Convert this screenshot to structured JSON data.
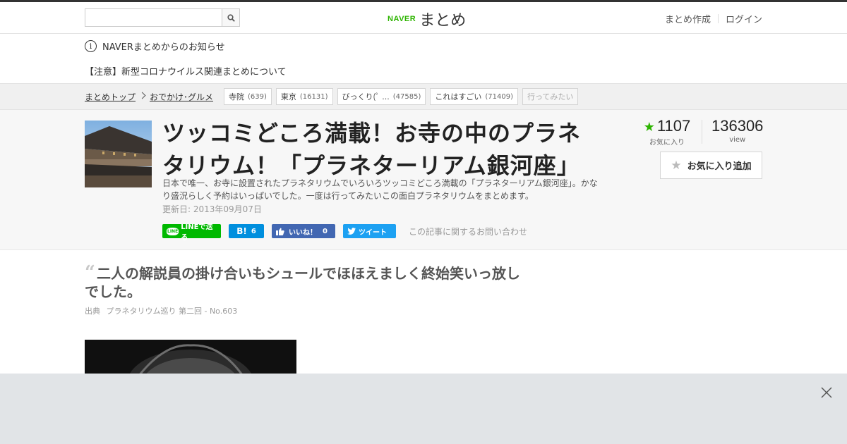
{
  "search": {
    "placeholder": "",
    "value": ""
  },
  "logo": {
    "naver": "NAVER",
    "matome": "まとめ"
  },
  "header_links": {
    "create": "まとめ作成",
    "login": "ログイン"
  },
  "notices": {
    "title": "NAVERまとめからのお知らせ",
    "item": "【注意】新型コロナウイルス関連まとめについて"
  },
  "breadcrumb": {
    "top": "まとめトップ",
    "category": "おでかけ･グルメ"
  },
  "tags": [
    {
      "label": "寺院",
      "count": "(639)"
    },
    {
      "label": "東京",
      "count": "(16131)"
    },
    {
      "label": "びっくり(ﾟ ...",
      "count": "(47585)"
    },
    {
      "label": "これはすごい",
      "count": "(71409)"
    },
    {
      "label": "行ってみたい",
      "count": ""
    }
  ],
  "article": {
    "title": "ツッコミどころ満載！お寺の中のプラネタリウム！「プラネターリアム銀河座」",
    "description": "日本で唯一、お寺に設置されたプラネタリウムでいろいろツッコミどころ満載の「プラネターリアム銀河座」。かなり盛況らしく予約はいっぱいでした。一度は行ってみたいこの面白プラネタリウムをまとめます。",
    "updated": "更新日: 2013年09月07日"
  },
  "share": {
    "line": "LINEで送る",
    "hatena": "B!",
    "hatena_count": "6",
    "facebook": "いいね！",
    "facebook_count": "0",
    "twitter": "ツイート",
    "inquiry": "この記事に関するお問い合わせ"
  },
  "stats": {
    "favorites": "1107",
    "favorites_label": "お気に入り",
    "views": "136306",
    "views_label": "view"
  },
  "fav_button": "お気に入り追加",
  "quote": {
    "text": "二人の解説員の掛け合いもシュールでほほえましく終始笑いっ放しでした。",
    "source_label": "出典",
    "source": "プラネタリウム巡り 第二回 - No.603"
  },
  "colors": {
    "naver_green": "#2db400",
    "line_green": "#00b900",
    "hatena_blue": "#008fde",
    "facebook_blue": "#4267b2",
    "twitter_blue": "#1da1f2"
  }
}
